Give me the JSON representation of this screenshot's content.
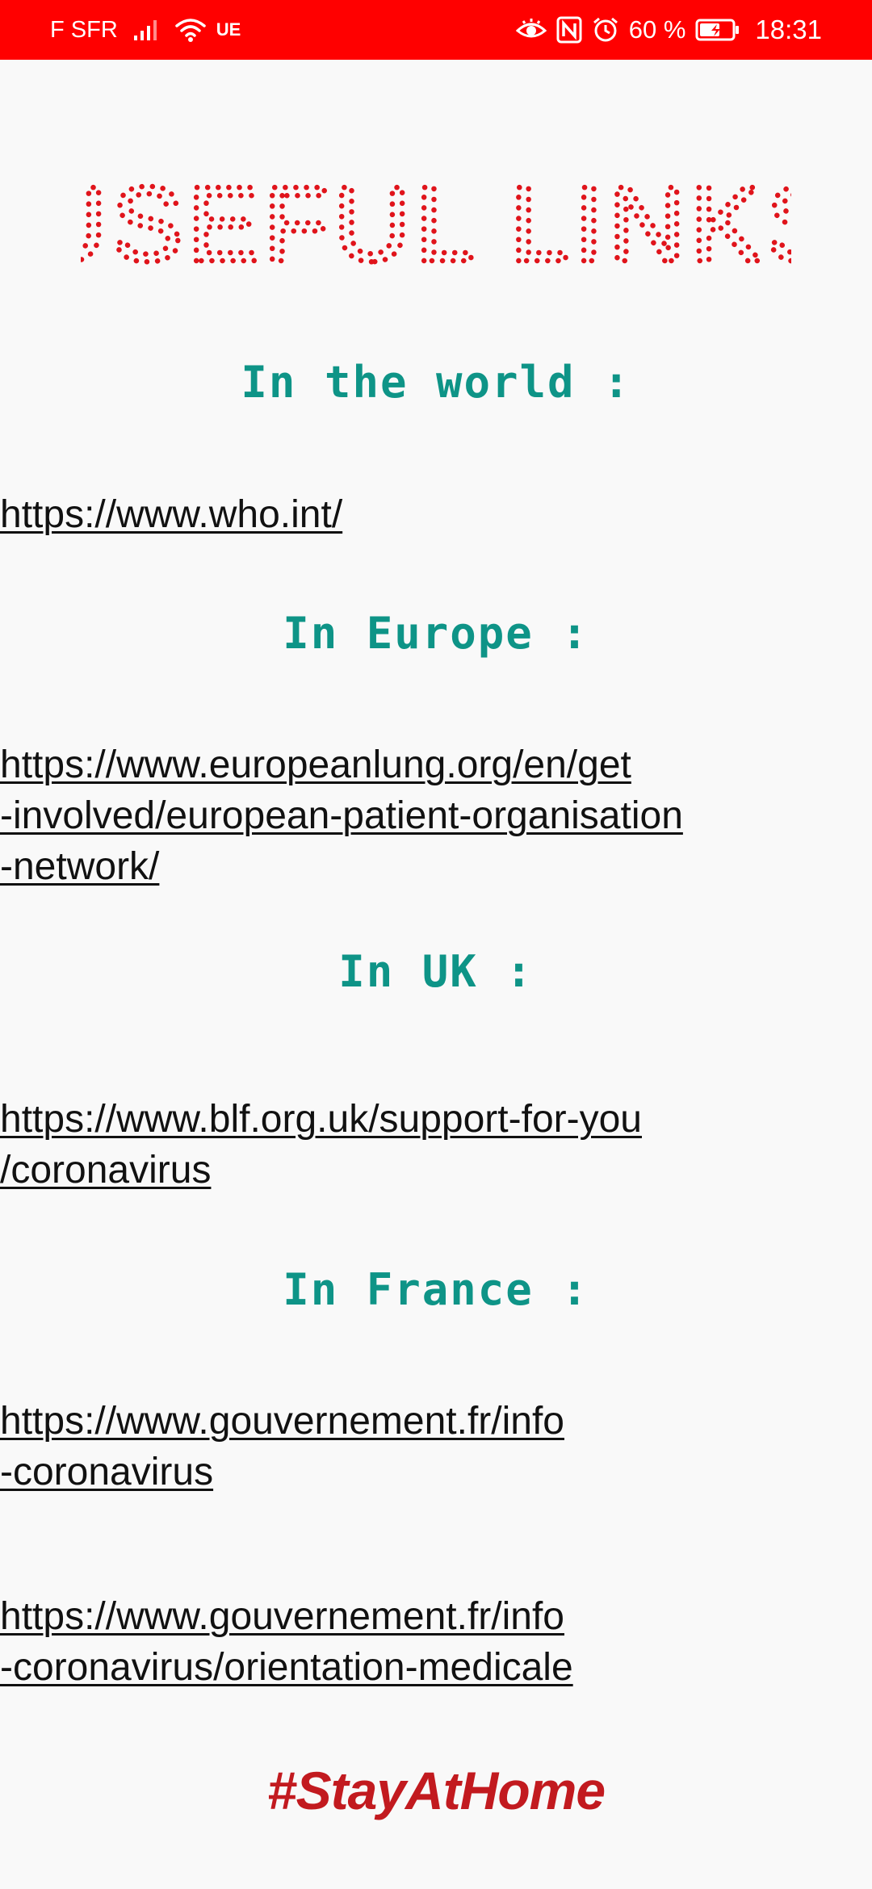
{
  "status_bar": {
    "carrier": "F SFR",
    "network_type": "UE",
    "battery_percent": "60 %",
    "time": "18:31",
    "icons": [
      "signal-icon",
      "wifi-icon",
      "eye-icon",
      "nfc-icon",
      "alarm-icon",
      "battery-charging-icon"
    ]
  },
  "title": "USEFUL LINKS",
  "colors": {
    "status_bar": "#ff0000",
    "title": "#e0141b",
    "heading": "#0e9487",
    "hashtag": "#c21a1f",
    "link": "#111111",
    "background": "#f9f9f9"
  },
  "sections": [
    {
      "heading": "In the world :",
      "links": [
        "https://www.who.int/"
      ]
    },
    {
      "heading": "In Europe :",
      "links": [
        "https://www.europeanlung.org/en/get\n-involved/european-patient-organisation\n-network/"
      ]
    },
    {
      "heading": "In UK :",
      "links": [
        "https://www.blf.org.uk/support-for-you\n/coronavirus"
      ]
    },
    {
      "heading": "In France :",
      "links": [
        "https://www.gouvernement.fr/info\n-coronavirus",
        "https://www.gouvernement.fr/info\n-coronavirus/orientation-medicale"
      ]
    }
  ],
  "hashtag": "#StayAtHome"
}
